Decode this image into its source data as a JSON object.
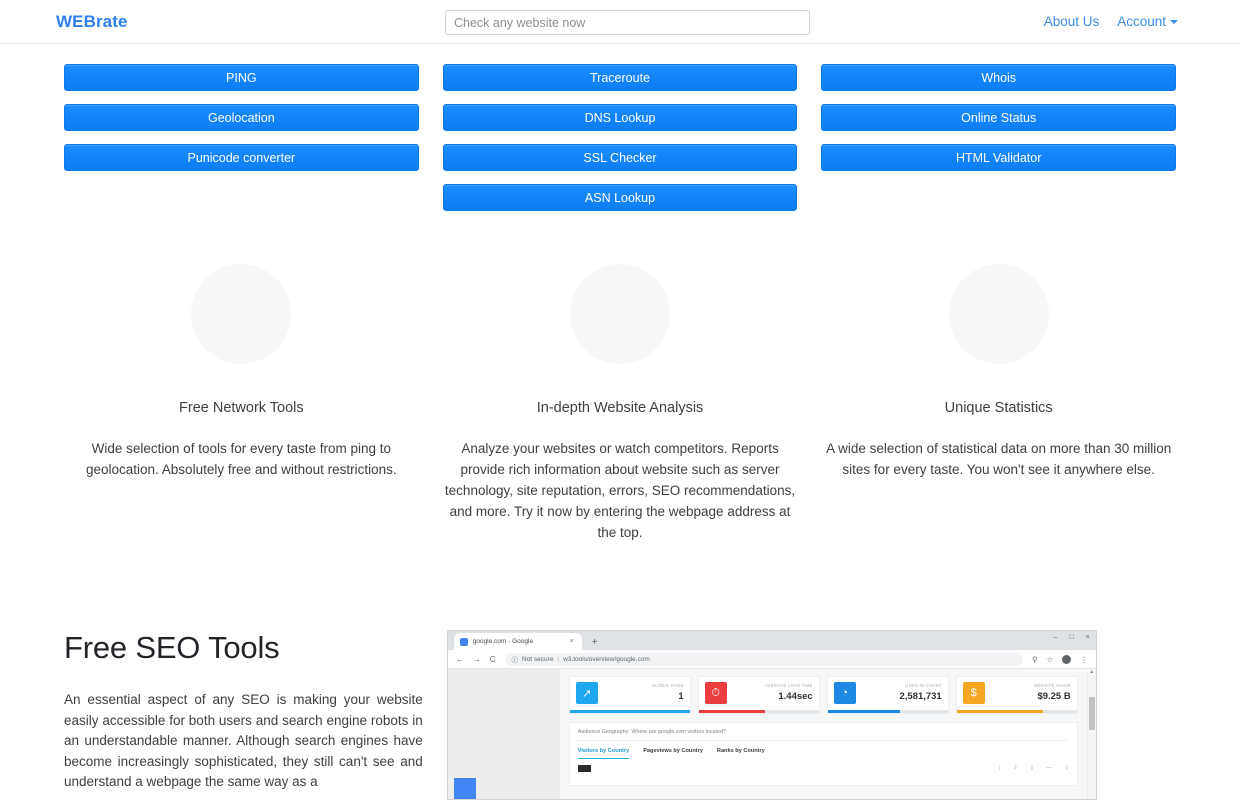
{
  "navbar": {
    "brand": "WEBrate",
    "search": {
      "placeholder": "Check any website now",
      "value": ""
    },
    "links": [
      {
        "label": "About Us",
        "name": "nav-link-about-us"
      },
      {
        "label": "Account",
        "name": "nav-link-account",
        "has_caret": true
      }
    ]
  },
  "tools": {
    "columns": [
      {
        "buttons": [
          "PING",
          "Geolocation",
          "Punicode converter"
        ]
      },
      {
        "buttons": [
          "Traceroute",
          "DNS Lookup",
          "SSL Checker",
          "ASN Lookup"
        ]
      },
      {
        "buttons": [
          "Whois",
          "Online Status",
          "HTML Validator"
        ]
      }
    ]
  },
  "features": [
    {
      "title": "Free Network Tools",
      "description": "Wide selection of tools for every taste from ping to geolocation. Absolutely free and without restrictions."
    },
    {
      "title": "In-depth Website Analysis",
      "description": "Analyze your websites or watch competitors. Reports provide rich information about website such as server technology, site reputation, errors, SEO recommendations, and more. Try it now by entering the webpage address at the top."
    },
    {
      "title": "Unique Statistics",
      "description": "A wide selection of statistical data on more than 30 million sites for every taste. You won't see it anywhere else."
    }
  ],
  "seo": {
    "title": "Free SEO Tools",
    "paragraph": "An essential aspect of any SEO is making your website easily accessible for both users and search engine robots in an understandable manner. Although search engines have become increasingly sophisticated, they still can't see and understand a webpage the same way as a"
  },
  "browser_mockup": {
    "tab_title": "google.com - Google",
    "tab_close": "×",
    "new_tab": "+",
    "window_controls": [
      "–",
      "□",
      "×"
    ],
    "nav_back": "←",
    "nav_forward": "→",
    "nav_reload": "C",
    "security_icon": "ⓘ",
    "security_label": "Not secure",
    "url": "w3.tools/overview/google.com",
    "toolbar_icons": [
      "search-icon",
      "star-icon",
      "profile-icon",
      "menu-icon"
    ],
    "stats": [
      {
        "label": "GLOBAL RANK",
        "value": "1",
        "color": "#1ea7ef",
        "icon": "↗",
        "bar_pct": 100
      },
      {
        "label": "AVERAGE LOAD TIME",
        "value": "1.44sec",
        "color": "#ea3d3d",
        "icon": "●",
        "bar_pct": 55
      },
      {
        "label": "LINKS IN COUNT",
        "value": "2,581,731",
        "color": "#1e88e5",
        "icon": "◔",
        "bar_pct": 60
      },
      {
        "label": "WEBSITE VALUE",
        "value": "$9.25 B",
        "color": "#f5a623",
        "icon": "$",
        "bar_pct": 72
      }
    ],
    "geo_question": "Audience Geography: Where are google.com visitors located?",
    "geo_tabs": [
      {
        "label": "Visitors by Country",
        "active": true
      },
      {
        "label": "Pageviews by Country",
        "active": false
      },
      {
        "label": "Ranks by Country",
        "active": false
      }
    ],
    "geo_controls": [
      "➕",
      "➖",
      "↓",
      "↑"
    ]
  },
  "colors": {
    "brand": "#2f80ed",
    "button_blue": "#1184fb",
    "link_blue": "#3a8ee6",
    "text": "#3c4043"
  }
}
